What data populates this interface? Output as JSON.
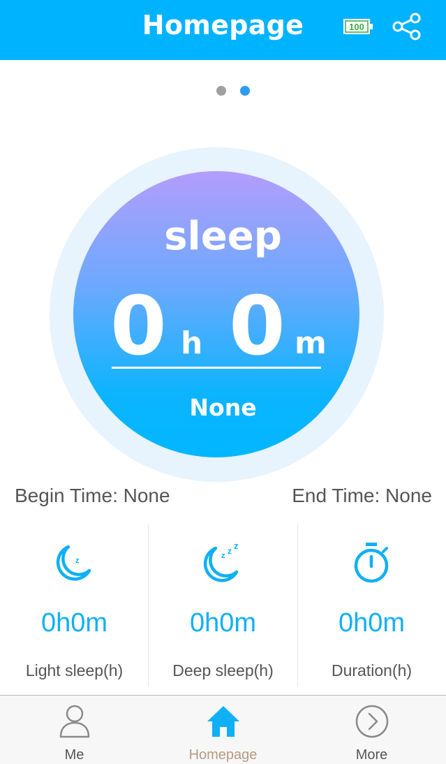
{
  "header": {
    "title": "Homepage",
    "battery_level": "100",
    "share_icon": "share-icon",
    "background_color": "#00b3ff"
  },
  "pager": {
    "pages": 2,
    "active_page": 2,
    "inactive_color": "#a0a0a0",
    "active_color": "#2d9bf0"
  },
  "sleep_summary": {
    "title": "sleep",
    "hours": "0",
    "hours_unit": "h",
    "minutes": "0",
    "minutes_unit": "m",
    "quality": "None"
  },
  "times": {
    "begin": "Begin Time: None",
    "end": "End Time: None"
  },
  "stats": [
    {
      "icon": "moon-icon",
      "value": "0h0m",
      "label": "Light sleep(h)"
    },
    {
      "icon": "moon-zzz-icon",
      "value": "0h0m",
      "label": "Deep sleep(h)"
    },
    {
      "icon": "stopwatch-icon",
      "value": "0h0m",
      "label": "Duration(h)"
    }
  ],
  "tabbar": {
    "items": [
      {
        "label": "Me",
        "icon": "person-icon",
        "active": false
      },
      {
        "label": "Homepage",
        "icon": "home-icon",
        "active": true
      },
      {
        "label": "More",
        "icon": "chevron-right-circle-icon",
        "active": false
      }
    ],
    "active_label_color": "#b59b80",
    "inactive_label_color": "#555555",
    "accent_color": "#0fb0f5"
  }
}
